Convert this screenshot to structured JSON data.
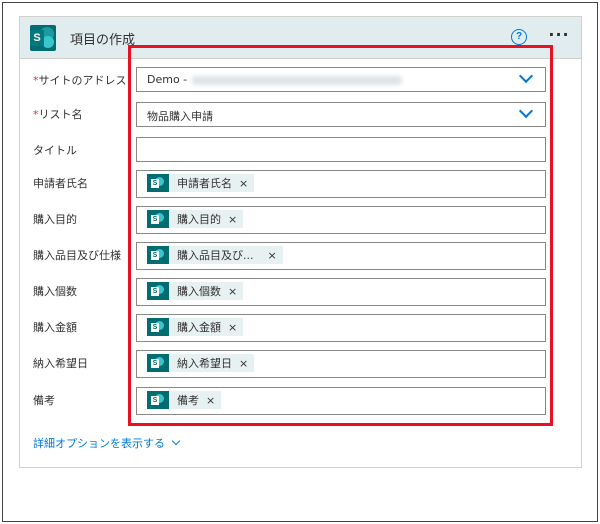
{
  "card": {
    "title": "項目の作成",
    "help_glyph": "?",
    "more_glyph": "···",
    "logo_letter": "S"
  },
  "fields": [
    {
      "label": "サイトのアドレス",
      "required": true,
      "kind": "dropdown",
      "value": "Demo -",
      "value_obscured": true
    },
    {
      "label": "リスト名",
      "required": true,
      "kind": "dropdown",
      "value": "物品購入申請"
    },
    {
      "label": "タイトル",
      "required": false,
      "kind": "text",
      "value": ""
    },
    {
      "label": "申請者氏名",
      "required": false,
      "kind": "token",
      "value": "申請者氏名"
    },
    {
      "label": "購入目的",
      "required": false,
      "kind": "token",
      "value": "購入目的"
    },
    {
      "label": "購入品目及び仕様",
      "required": false,
      "kind": "token",
      "value": "購入品目及び..."
    },
    {
      "label": "購入個数",
      "required": false,
      "kind": "token",
      "value": "購入個数"
    },
    {
      "label": "購入金額",
      "required": false,
      "kind": "token",
      "value": "購入金額"
    },
    {
      "label": "納入希望日",
      "required": false,
      "kind": "token",
      "value": "納入希望日"
    },
    {
      "label": "備考",
      "required": false,
      "kind": "token",
      "value": "備考"
    }
  ],
  "required_mark": "*",
  "token_close": "×",
  "advanced_options": "詳細オプションを表示する",
  "colors": {
    "accent": "#0078d4",
    "highlight_border": "#e81123",
    "sharepoint": "#036c70",
    "header_bg": "#e1ecef"
  },
  "icons": {
    "logo": "sharepoint-logo-icon",
    "token": "sharepoint-token-icon",
    "help": "help-icon",
    "more": "more-icon",
    "dropdown": "chevron-down-icon"
  }
}
